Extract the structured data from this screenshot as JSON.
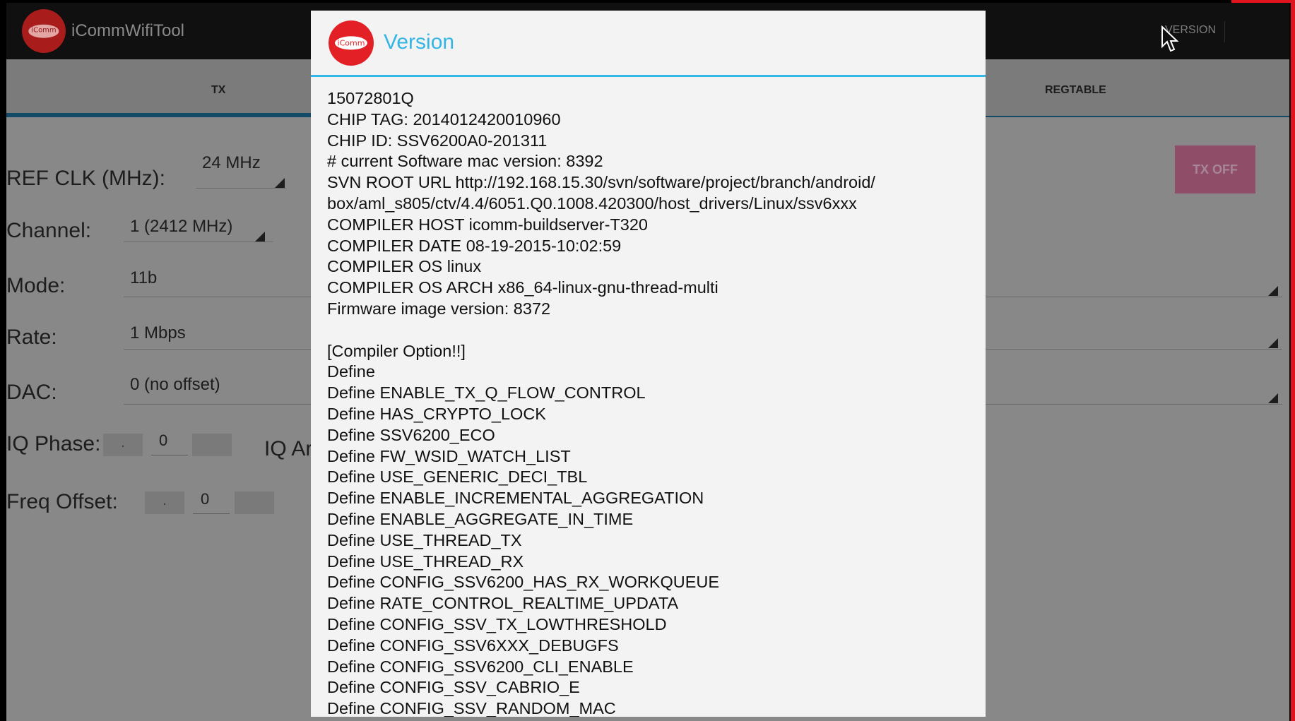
{
  "app": {
    "title": "iCommWifiTool",
    "logo_text": "iComm",
    "action_version": "VERSION",
    "tabs": [
      {
        "label": "TX"
      },
      {
        "label": "REGTABLE"
      }
    ],
    "form": {
      "ref_clk_label": "REF CLK (MHz):",
      "ref_clk_value": "24 MHz",
      "channel_label": "Channel:",
      "channel_value": "1 (2412 MHz)",
      "mode_label": "Mode:",
      "mode_value": "11b",
      "rate_label": "Rate:",
      "rate_value": "1 Mbps",
      "dac_label": "DAC:",
      "dac_value": "0 (no offset)",
      "iq_phase_label": "IQ Phase:",
      "iq_phase_value": "0",
      "iq_amp_label": "IQ Ar",
      "freq_offset_label": "Freq Offset:",
      "freq_offset_value": "0",
      "decrement_symbol": "."
    },
    "tx_off_label": "TX OFF"
  },
  "dialog": {
    "title": "Version",
    "logo_text": "iComm",
    "lines": [
      "15072801Q",
      "CHIP TAG: 2014012420010960",
      "CHIP ID: SSV6200A0-201311",
      "# current Software mac version: 8392",
      "SVN ROOT URL http://192.168.15.30/svn/software/project/branch/android/",
      "box/aml_s805/ctv/4.4/6051.Q0.1008.420300/host_drivers/Linux/ssv6xxx",
      "COMPILER HOST icomm-buildserver-T320",
      "COMPILER DATE 08-19-2015-10:02:59",
      "COMPILER OS linux",
      "COMPILER OS ARCH x86_64-linux-gnu-thread-multi",
      "Firmware image version: 8372",
      "",
      "[Compiler Option!!]",
      "Define",
      "Define ENABLE_TX_Q_FLOW_CONTROL",
      "Define HAS_CRYPTO_LOCK",
      "Define SSV6200_ECO",
      "Define FW_WSID_WATCH_LIST",
      "Define USE_GENERIC_DECI_TBL",
      "Define ENABLE_INCREMENTAL_AGGREGATION",
      "Define ENABLE_AGGREGATE_IN_TIME",
      "Define USE_THREAD_TX",
      "Define USE_THREAD_RX",
      "Define CONFIG_SSV6200_HAS_RX_WORKQUEUE",
      "Define RATE_CONTROL_REALTIME_UPDATA",
      "Define CONFIG_SSV_TX_LOWTHRESHOLD",
      "Define CONFIG_SSV6XXX_DEBUGFS",
      "Define CONFIG_SSV6200_CLI_ENABLE",
      "Define CONFIG_SSV_CABRIO_E",
      "Define CONFIG_SSV_RANDOM_MAC"
    ]
  },
  "colors": {
    "accent": "#33b5e5",
    "brand_red": "#e32026",
    "tx_off_button": "#8f4d68"
  },
  "icons": {
    "cursor": "mouse-pointer-icon"
  }
}
